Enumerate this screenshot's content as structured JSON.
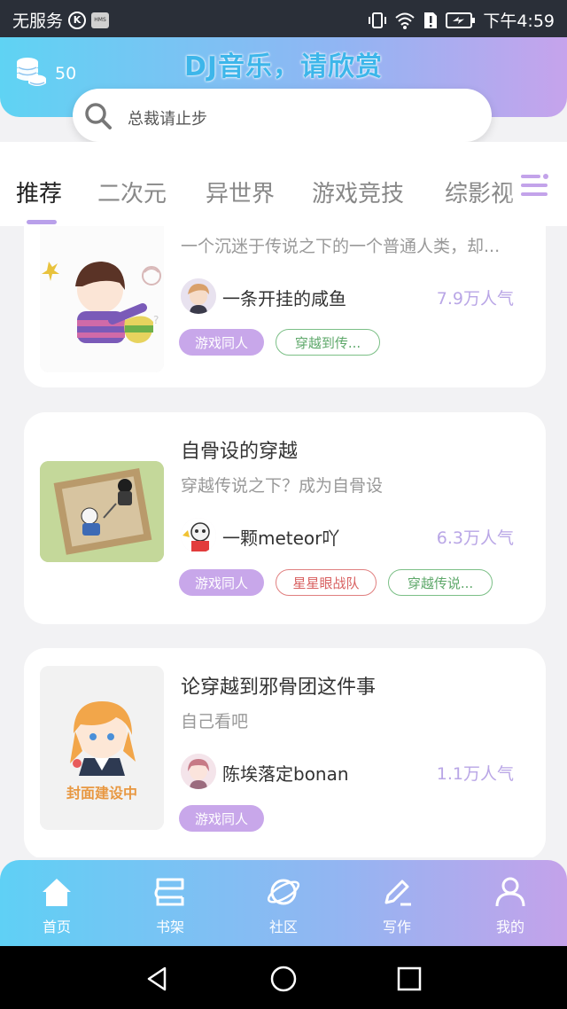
{
  "status_bar": {
    "carrier": "无服务",
    "k_badge": "K",
    "hms_badge": "HMS",
    "time": "下午4:59",
    "icons": [
      "vibrate-icon",
      "wifi-icon",
      "sim-alert-icon",
      "battery-charging-icon"
    ]
  },
  "header": {
    "title": "DJ音乐，请欣赏",
    "coins": "50",
    "coin_icon": "coin-stack-icon"
  },
  "search": {
    "placeholder": "总裁请止步",
    "icon": "search-icon"
  },
  "tabs": [
    {
      "label": "推荐",
      "active": true
    },
    {
      "label": "二次元",
      "active": false
    },
    {
      "label": "异世界",
      "active": false
    },
    {
      "label": "游戏竞技",
      "active": false
    },
    {
      "label": "综影视",
      "active": false
    }
  ],
  "books": [
    {
      "title": "",
      "desc": "一个沉迷于传说之下的一个普通人类，却...",
      "author": "一条开挂的咸鱼",
      "popularity": "7.9万人气",
      "tags": [
        {
          "label": "游戏同人",
          "style": "purple"
        },
        {
          "label": "穿越到传...",
          "style": "green"
        }
      ]
    },
    {
      "title": "自骨设的穿越",
      "desc": "穿越传说之下？成为自骨设",
      "author": "一颗meteor吖",
      "popularity": "6.3万人气",
      "tags": [
        {
          "label": "游戏同人",
          "style": "purple"
        },
        {
          "label": "星星眼战队",
          "style": "red"
        },
        {
          "label": "穿越传说...",
          "style": "green"
        }
      ]
    },
    {
      "title": "论穿越到邪骨团这件事",
      "desc": "自己看吧",
      "author": "陈埃落定bonan",
      "popularity": "1.1万人气",
      "cover_caption": "封面建设中",
      "tags": [
        {
          "label": "游戏同人",
          "style": "purple"
        }
      ]
    }
  ],
  "bottom_nav": [
    {
      "label": "首页",
      "icon": "home-icon"
    },
    {
      "label": "书架",
      "icon": "bookshelf-icon"
    },
    {
      "label": "社区",
      "icon": "planet-icon"
    },
    {
      "label": "写作",
      "icon": "pen-icon"
    },
    {
      "label": "我的",
      "icon": "user-icon"
    }
  ],
  "colors": {
    "accent_purple": "#c8a7ea",
    "header_gradient_start": "#5fd3f3",
    "header_gradient_end": "#c6a3ec",
    "popularity": "#b9a6e6"
  }
}
